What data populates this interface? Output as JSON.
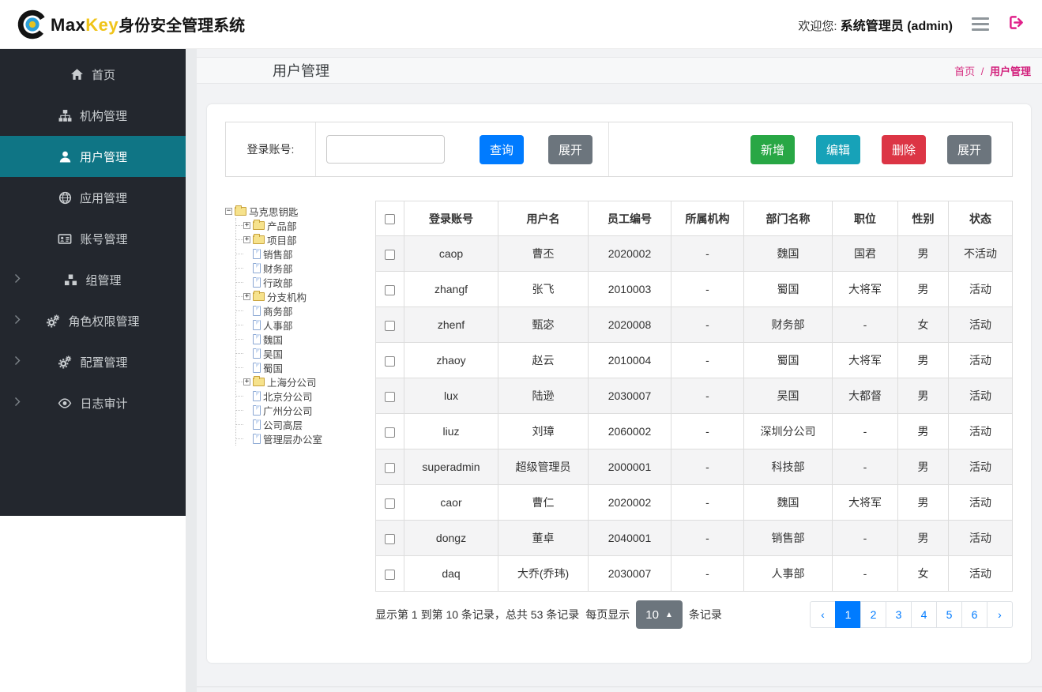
{
  "header": {
    "brand": {
      "max": "Max",
      "key": "Key",
      "suffix": "身份安全管理系统"
    },
    "welcome_prefix": "欢迎您:",
    "welcome_user": "系统管理员 (admin)"
  },
  "sidebar": {
    "items": [
      {
        "key": "home",
        "label": "首页",
        "icon": "home-icon",
        "active": false,
        "chevron": false
      },
      {
        "key": "org",
        "label": "机构管理",
        "icon": "sitemap-icon",
        "active": false,
        "chevron": false
      },
      {
        "key": "user",
        "label": "用户管理",
        "icon": "user-icon",
        "active": true,
        "chevron": false
      },
      {
        "key": "app",
        "label": "应用管理",
        "icon": "globe-icon",
        "active": false,
        "chevron": false
      },
      {
        "key": "account",
        "label": "账号管理",
        "icon": "idcard-icon",
        "active": false,
        "chevron": false
      },
      {
        "key": "group",
        "label": "组管理",
        "icon": "cubes-icon",
        "active": false,
        "chevron": true
      },
      {
        "key": "role",
        "label": "角色权限管理",
        "icon": "cogs-icon",
        "active": false,
        "chevron": true
      },
      {
        "key": "config",
        "label": "配置管理",
        "icon": "cogs-icon",
        "active": false,
        "chevron": true
      },
      {
        "key": "audit",
        "label": "日志审计",
        "icon": "eye-icon",
        "active": false,
        "chevron": true
      }
    ]
  },
  "page": {
    "title": "用户管理",
    "breadcrumb": {
      "home": "首页",
      "sep": "/",
      "current": "用户管理"
    }
  },
  "toolbar": {
    "search_label": "登录账号:",
    "search_value": "",
    "query_label": "查询",
    "expand_label": "展开",
    "add_label": "新增",
    "edit_label": "编辑",
    "delete_label": "删除",
    "expand_right_label": "展开"
  },
  "tree": {
    "nodes": [
      {
        "label": "马克思钥匙",
        "type": "folder-open",
        "expander": "minus",
        "level": 0
      },
      {
        "label": "产品部",
        "type": "folder",
        "expander": "plus",
        "level": 1
      },
      {
        "label": "项目部",
        "type": "folder",
        "expander": "plus",
        "level": 1
      },
      {
        "label": "销售部",
        "type": "file",
        "expander": "none",
        "level": 1
      },
      {
        "label": "财务部",
        "type": "file",
        "expander": "none",
        "level": 1
      },
      {
        "label": "行政部",
        "type": "file",
        "expander": "none",
        "level": 1
      },
      {
        "label": "分支机构",
        "type": "folder",
        "expander": "plus",
        "level": 1
      },
      {
        "label": "商务部",
        "type": "file",
        "expander": "none",
        "level": 1
      },
      {
        "label": "人事部",
        "type": "file",
        "expander": "none",
        "level": 1
      },
      {
        "label": "魏国",
        "type": "file",
        "expander": "none",
        "level": 1
      },
      {
        "label": "吴国",
        "type": "file",
        "expander": "none",
        "level": 1
      },
      {
        "label": "蜀国",
        "type": "file",
        "expander": "none",
        "level": 1
      },
      {
        "label": "上海分公司",
        "type": "folder",
        "expander": "plus",
        "level": 1
      },
      {
        "label": "北京分公司",
        "type": "file",
        "expander": "none",
        "level": 1
      },
      {
        "label": "广州分公司",
        "type": "file",
        "expander": "none",
        "level": 1
      },
      {
        "label": "公司高层",
        "type": "file",
        "expander": "none",
        "level": 1
      },
      {
        "label": "管理层办公室",
        "type": "file",
        "expander": "none",
        "level": 1
      }
    ]
  },
  "table": {
    "columns": [
      "登录账号",
      "用户名",
      "员工编号",
      "所属机构",
      "部门名称",
      "职位",
      "性别",
      "状态"
    ],
    "rows": [
      [
        "caop",
        "曹丕",
        "2020002",
        "-",
        "魏国",
        "国君",
        "男",
        "不活动"
      ],
      [
        "zhangf",
        "张飞",
        "2010003",
        "-",
        "蜀国",
        "大将军",
        "男",
        "活动"
      ],
      [
        "zhenf",
        "甄宓",
        "2020008",
        "-",
        "财务部",
        "-",
        "女",
        "活动"
      ],
      [
        "zhaoy",
        "赵云",
        "2010004",
        "-",
        "蜀国",
        "大将军",
        "男",
        "活动"
      ],
      [
        "lux",
        "陆逊",
        "2030007",
        "-",
        "吴国",
        "大都督",
        "男",
        "活动"
      ],
      [
        "liuz",
        "刘璋",
        "2060002",
        "-",
        "深圳分公司",
        "-",
        "男",
        "活动"
      ],
      [
        "superadmin",
        "超级管理员",
        "2000001",
        "-",
        "科技部",
        "-",
        "男",
        "活动"
      ],
      [
        "caor",
        "曹仁",
        "2020002",
        "-",
        "魏国",
        "大将军",
        "男",
        "活动"
      ],
      [
        "dongz",
        "董卓",
        "2040001",
        "-",
        "销售部",
        "-",
        "男",
        "活动"
      ],
      [
        "daq",
        "大乔(乔玮)",
        "2030007",
        "-",
        "人事部",
        "-",
        "女",
        "活动"
      ]
    ]
  },
  "pagination": {
    "info_records": "显示第 1 到第 10 条记录，总共 53 条记录",
    "info_pagesize_prefix": "每页显示",
    "page_size": "10",
    "caret": "▲",
    "info_pagesize_suffix": "条记录",
    "prev": "‹",
    "next": "›",
    "pages": [
      "1",
      "2",
      "3",
      "4",
      "5",
      "6"
    ],
    "active_page": "1"
  },
  "colors": {
    "sidebar_bg": "#23272e",
    "sidebar_active": "#0f7585",
    "brand_yellow": "#f0c419",
    "breadcrumb_pink": "#d63384",
    "logout_pink": "#e0218a",
    "btn_query": "#007bff",
    "btn_add": "#28a745",
    "btn_edit": "#17a2b8",
    "btn_delete": "#dc3545",
    "btn_gray": "#6c757d",
    "stripe_row": "#f4f4f5"
  }
}
